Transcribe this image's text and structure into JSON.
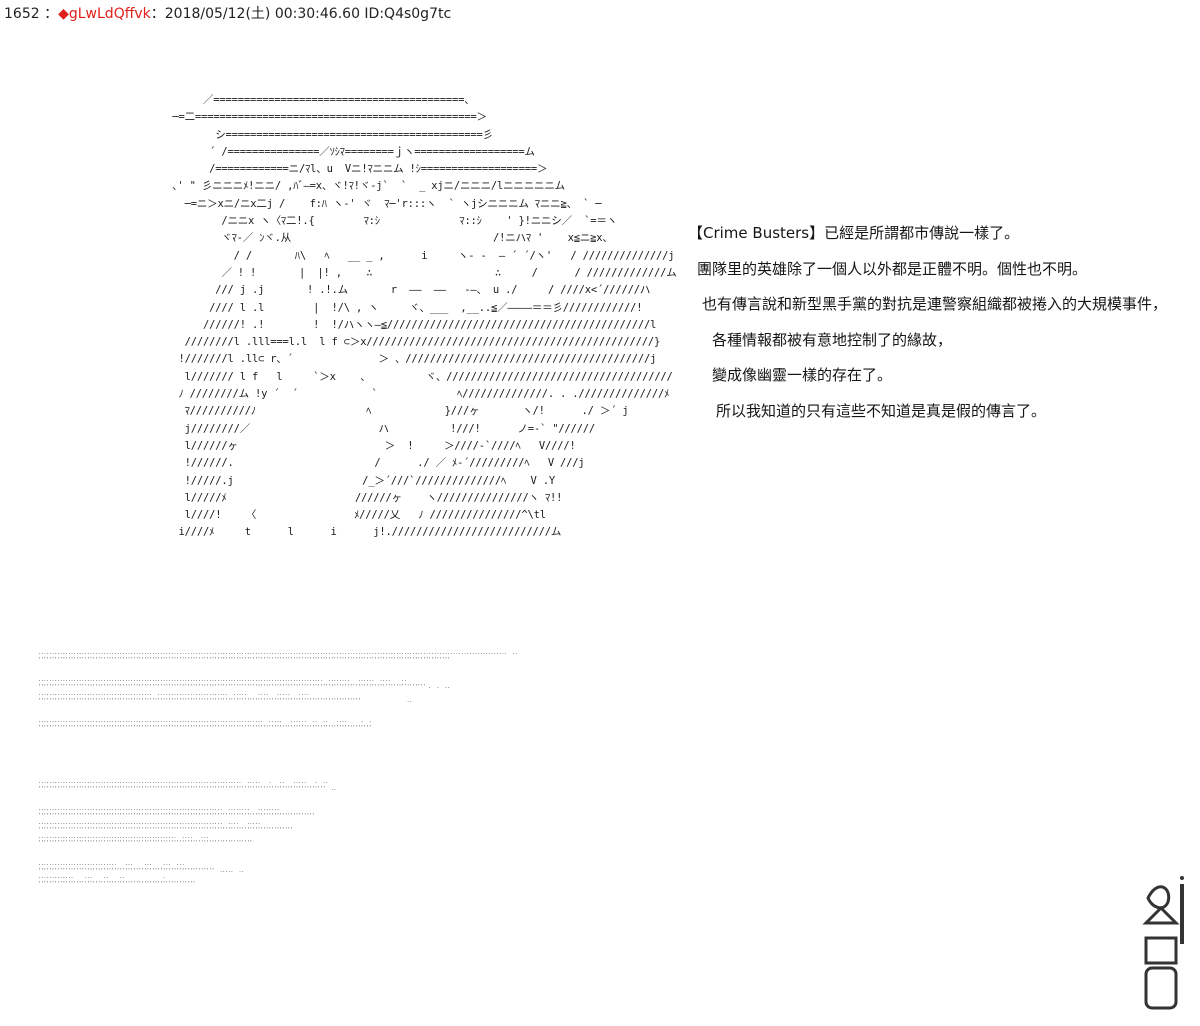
{
  "post_header": {
    "number": "1652",
    "separator": " ：",
    "diamond": "◆",
    "trip": "gLwLdQffvk",
    "datetime": "：2018/05/12(土) 00:30:46.60 ID:Q4s0g7tc"
  },
  "ascii_art": "        ／=========================================、\n   ─=二==============================================＞\n          シ==========================================彡\n         ´ /===============／ｿｼﾏ========ｊヽ==================ム\n         /============ニ/ﾏl、u  Vニ!ﾏニニム !ｼ===================＞\n   ､' \" 彡ニニニﾒ!ニニ/ ,ﾊﾞ―=x、ヾ!ﾏ!ヾ-j`  `  _ xjニ/ニニニ/lニニニニニム\n     ─=ニ＞xニ/ニx二j /    f:ﾊ ヽ-' ヾ  ﾏ─'r:::ヽ  ` ヽjシニニニム ﾏニニ≧、 ` ─\n           /ニニx ヽ〈ﾏ二!.{        ﾏ:ｼ             ﾏ::ｼ    ' }!ニニシ／  `=＝ヽ\n           ヾﾏ-／ ﾝヾ.从                                 /!ニハﾏ '    x≦ニ≧x、\n             / /       ﾊ\\   ﾍ   __ _ ,      i     ヽ- -  ― ´ ´/ヽ'   / //////////////j\n           ／ ! !       |  |! ,    ∴                    ∴     /      / /////////////ム\n          /// j .j       ! .!.ム       r  ――  ――   -―、 u ./     / ////x<´//////ハ\n         //// l .l        |  !/\\ , ヽ     ヾ、___  ,__..≦／――――＝＝彡////////////!\n        //////! .!        !  !/ハヽヽ―≦///////////////////////////////////////////l\n     ////////l .lll===l.l  l f ⊂＞x///////////////////////////////////////////////}\n    !///////l .ll⊂ r、´              ＞ 、////////////////////////////////////////j\n     l/////// l f   l     `＞x    、         ヾ、/////////////////////////////////////\n    ﾉ ////////ム !y ´  ´            `             ﾍ//////////////. . .//////////////ﾒ\n     ﾏ//////////ﾉ                  ﾍ            }///ヶ       ヽ/!      ./ ＞´ j\n     j////////／                     ハ          !///!      ノ=-` \"//////\n     l//////ヶ                        ＞  !     ＞////-`////ﾍ   V////!\n     !//////.                       /      ./ ／ ﾒ-´/////////ﾍ   V ///j\n     !/////.j                     /_＞´///`//////////////ﾍ    V .Y\n     l/////ﾒ                     //////ヶ    ヽ///////////////ヽ ﾏ!!\n     l////!    〈                ﾒ/////乂   ﾉ ///////////////^\\tl\n    i////ﾒ     t      l      i      j!.//////////////////////////ム",
  "narration": [
    "【Crime Busters】已經是所謂都市傳說一樣了。",
    "團隊里的英雄除了一個人以外都是正體不明。個性也不明。",
    "也有傳言說和新型黑手黨的對抗是連警察組織都被捲入的大規模事件，",
    "各種情報都被有意地控制了的緣故，",
    "變成像幽靈一樣的存在了。",
    "所以我知道的只有這些不知道是真是假的傳言了。"
  ],
  "dotted_filler": ".............................................................................................................................................................................  ..\n''''''''''''''''''''''''''''''''''''''''''''''''''''''''''''''''''''''''''''''''''''''''''''''''''''''''''''''''''''''''''''''''''''''''''''''''''''''''\n\n\n.........................................................................................................  ........   ......  ....    ..\n''''''''''''''''''''''''''''''''''''''''''''''''''''''''''''''''''''''''''''''''''''''''''''''''''''''''''''''''''''''''''''''''''''''''''''''' .  .  ..\n..........................................  ..........................  .....    ....   .....   ....\n'''''''''''''''''''''''''''''''''''''''''''''''''''''''''''''''''''''''''''''''''''''''''''''''''''''''''''''''''''''''                 ..\n\n\n...................................................................................  .....   ......  ..  ..   ....     .  .\n'''''''''''''''''''''''''''''''''''''''''''''''''''''''''''''''''''''''''''''''''''''''''''''''''''''''''''''''''''''''''''\n\n\n\n\n\n\n\n...........................................................................  .....   .   ..   .....   .  ..\n''''''''''''''''''''''''''''''''''''''''''''''''''''''''''''''''''''''''''''''''''''''''''''''''''''''''''  ..\n\n\n....................................................................  ........   ........\n''''''''''''''''''''''''''''''''''''''''''''''''''''''''''''''''''''''''''''''''''''''''''''''''''''''\n....................................................................  ....   .....\n''''''''''''''''''''''''''''''''''''''''''''''''''''''''''''''''''''''''''''''''''''''''''''''\n...................................................  ....   ...\n'''''''''''''''''''''''''''''''''''''''''''''''''''''''''''''''''''''''''''''''\n\n\n.............................   ...    ...    ...  ...\n'''''''''''''''''''''''''''''''''''''''''''''''''''''''''''''''''  .....  ..\n.............    ...    ..    ..              .\n''''''''''''''''''''''''''''''''''''''''''''''''''''''''''"
}
